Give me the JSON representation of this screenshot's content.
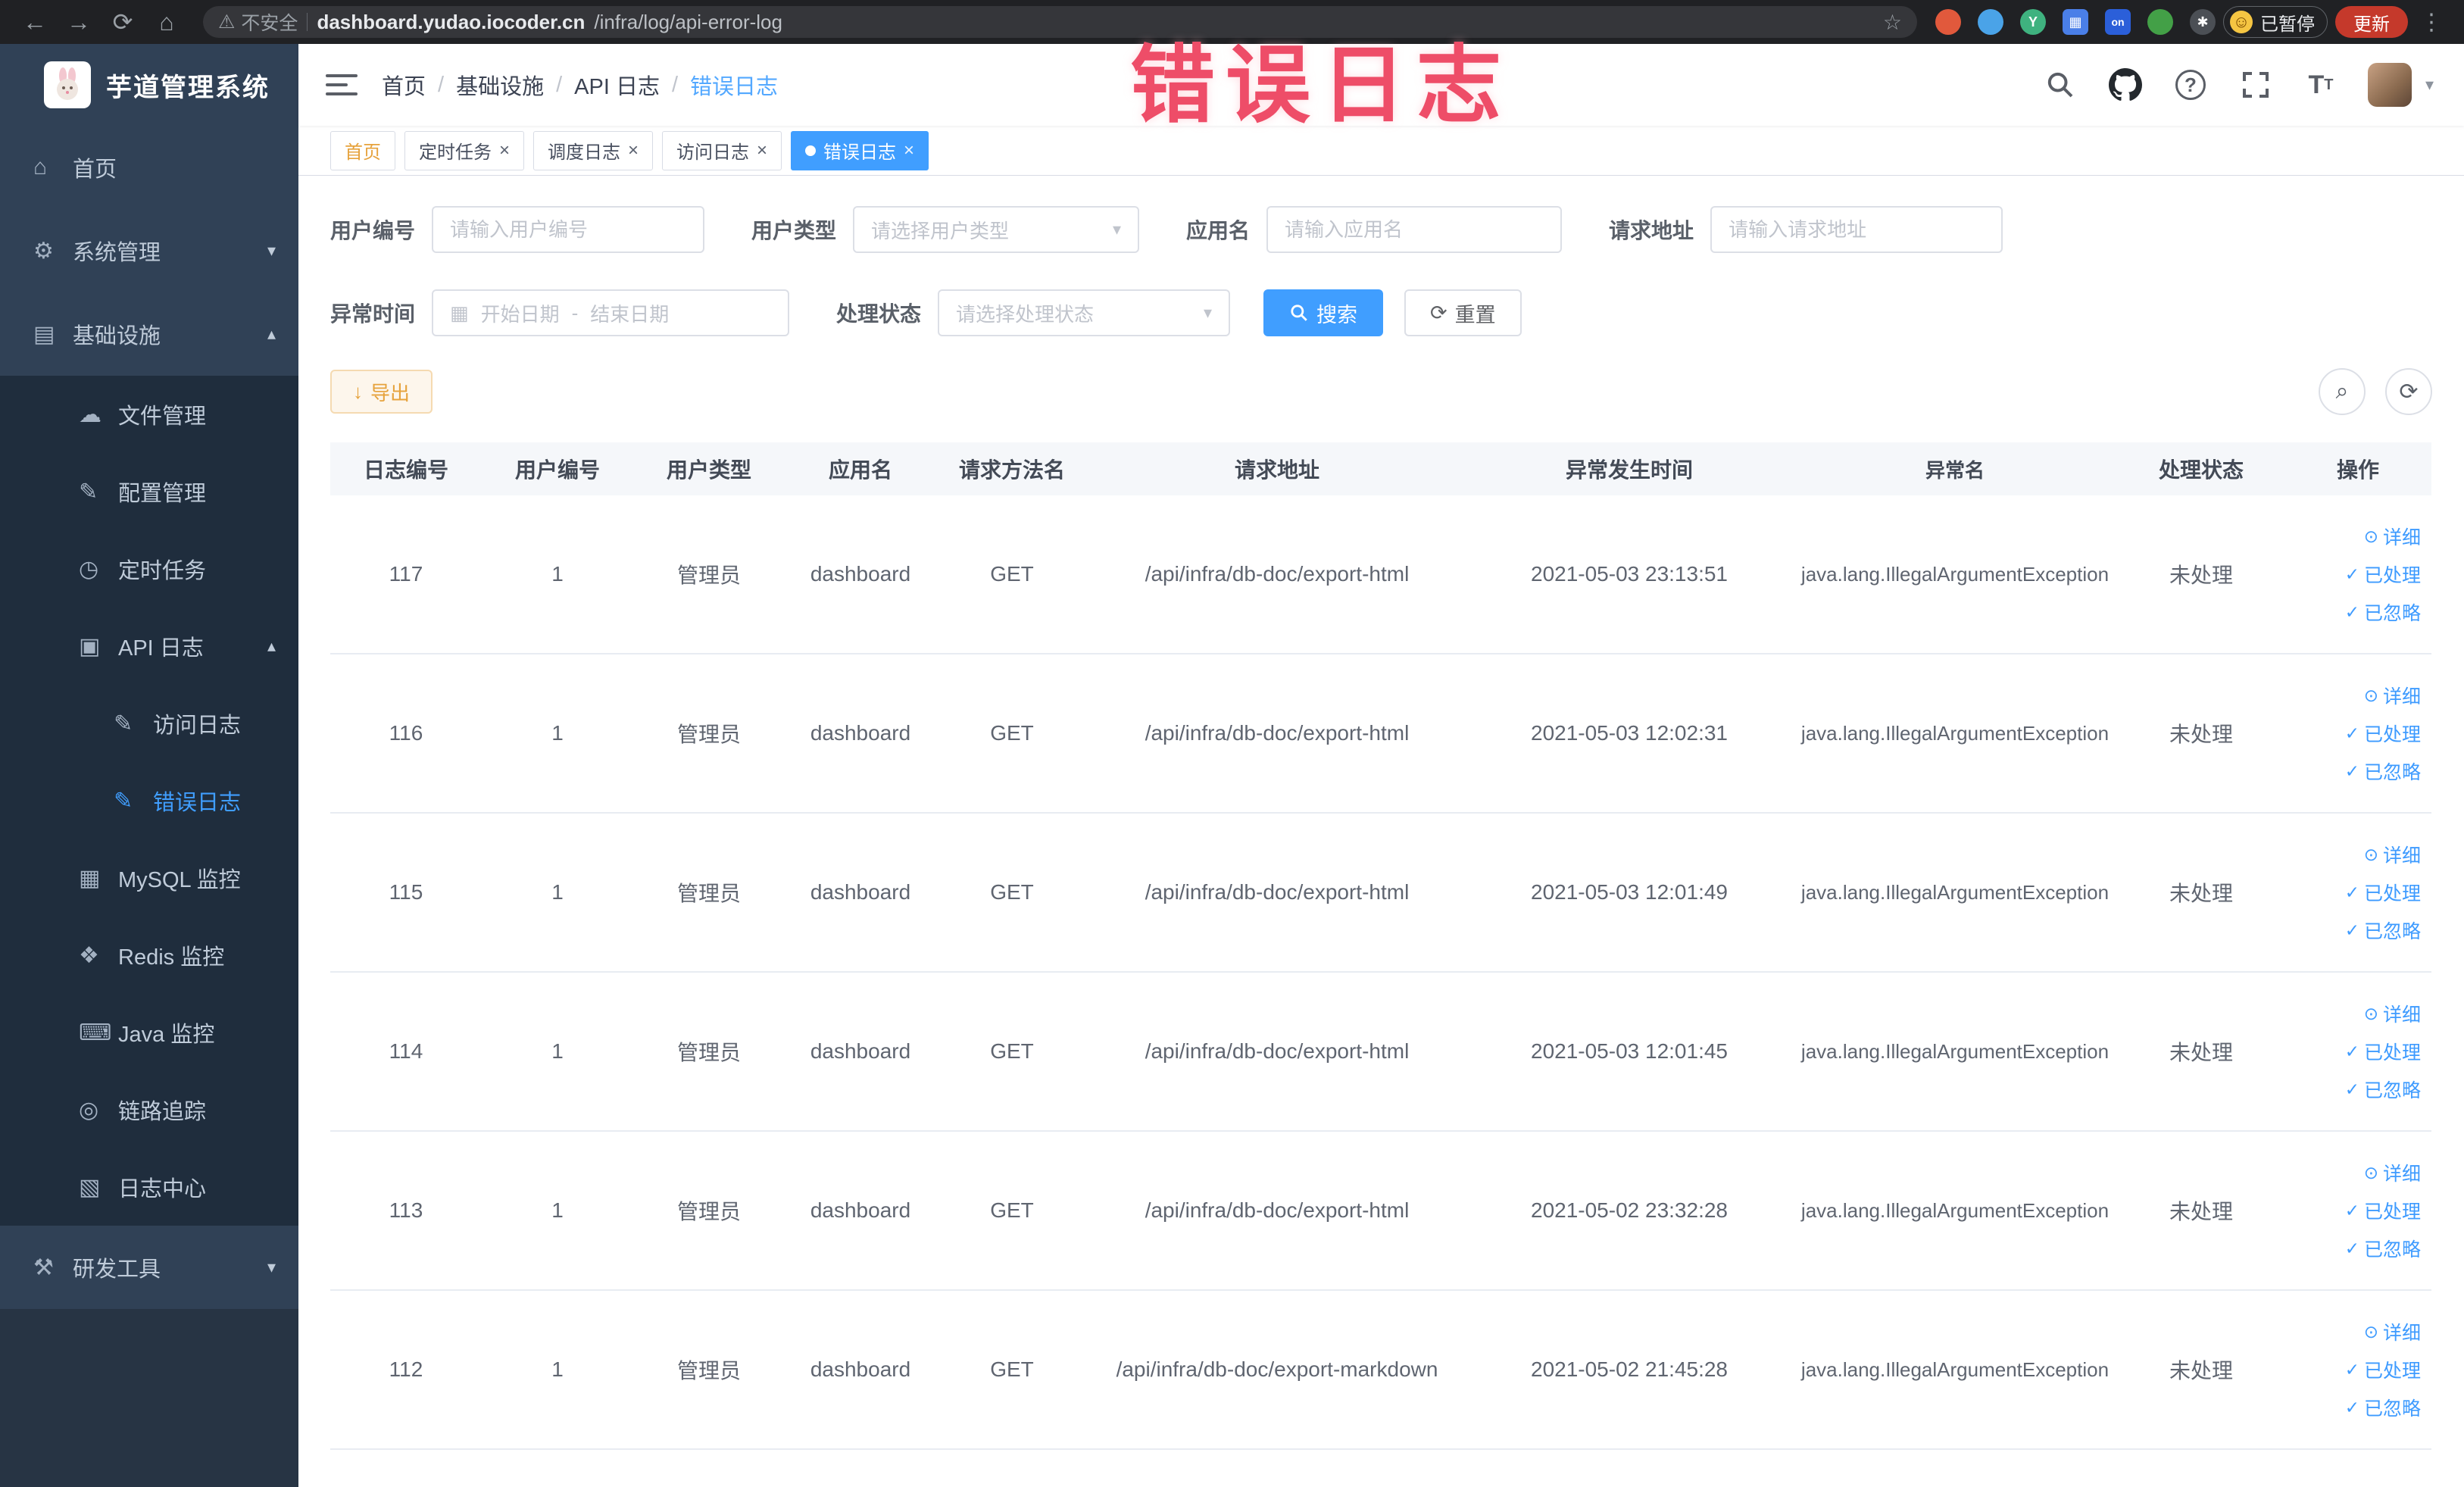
{
  "annotation": {
    "text": "错误日志"
  },
  "browser": {
    "security_label": "不安全",
    "url_host": "dashboard.yudao.iocoder.cn",
    "url_path": "/infra/log/api-error-log",
    "paused_badge": "已暂停",
    "update_button": "更新"
  },
  "sidebar": {
    "logo_title": "芋道管理系统",
    "items": [
      {
        "name": "home",
        "label": "首页",
        "level": 1,
        "icon": "home-icon"
      },
      {
        "name": "system",
        "label": "系统管理",
        "level": 1,
        "icon": "gear-icon",
        "arrow": "down"
      },
      {
        "name": "infra",
        "label": "基础设施",
        "level": 1,
        "icon": "infra-icon",
        "arrow": "up"
      },
      {
        "name": "file",
        "label": "文件管理",
        "level": 2,
        "icon": "cloud-icon"
      },
      {
        "name": "config",
        "label": "配置管理",
        "level": 2,
        "icon": "edit-icon"
      },
      {
        "name": "job",
        "label": "定时任务",
        "level": 2,
        "icon": "timer-icon"
      },
      {
        "name": "api-log",
        "label": "API 日志",
        "level": 2,
        "icon": "log-icon",
        "arrow": "up"
      },
      {
        "name": "access-log",
        "label": "访问日志",
        "level": 3,
        "icon": "doc-icon"
      },
      {
        "name": "error-log",
        "label": "错误日志",
        "level": 3,
        "icon": "doc-icon",
        "active": true
      },
      {
        "name": "mysql",
        "label": "MySQL 监控",
        "level": 2,
        "icon": "mysql-icon"
      },
      {
        "name": "redis",
        "label": "Redis 监控",
        "level": 2,
        "icon": "redis-icon"
      },
      {
        "name": "java",
        "label": "Java 监控",
        "level": 2,
        "icon": "java-icon"
      },
      {
        "name": "trace",
        "label": "链路追踪",
        "level": 2,
        "icon": "trace-icon"
      },
      {
        "name": "logcenter",
        "label": "日志中心",
        "level": 2,
        "icon": "logcenter-icon"
      },
      {
        "name": "devtools",
        "label": "研发工具",
        "level": 1,
        "icon": "tools-icon",
        "arrow": "down"
      }
    ]
  },
  "header": {
    "breadcrumb": [
      "首页",
      "基础设施",
      "API 日志",
      "错误日志"
    ]
  },
  "tabs": [
    {
      "name": "home",
      "label": "首页",
      "affix": true
    },
    {
      "name": "job",
      "label": "定时任务",
      "closable": true
    },
    {
      "name": "job-log",
      "label": "调度日志",
      "closable": true
    },
    {
      "name": "access-log",
      "label": "访问日志",
      "closable": true
    },
    {
      "name": "error-log",
      "label": "错误日志",
      "closable": true,
      "active": true
    }
  ],
  "filters": {
    "user_id": {
      "label": "用户编号",
      "placeholder": "请输入用户编号"
    },
    "user_type": {
      "label": "用户类型",
      "placeholder": "请选择用户类型"
    },
    "app_name": {
      "label": "应用名",
      "placeholder": "请输入应用名"
    },
    "request_url": {
      "label": "请求地址",
      "placeholder": "请输入请求地址"
    },
    "exception_time": {
      "label": "异常时间",
      "start_placeholder": "开始日期",
      "separator": "-",
      "end_placeholder": "结束日期"
    },
    "process_status": {
      "label": "处理状态",
      "placeholder": "请选择处理状态"
    },
    "search_button": "搜索",
    "reset_button": "重置"
  },
  "toolbar": {
    "export_button": "导出"
  },
  "table": {
    "columns": [
      "日志编号",
      "用户编号",
      "用户类型",
      "应用名",
      "请求方法名",
      "请求地址",
      "异常发生时间",
      "异常名",
      "处理状态",
      "操作"
    ],
    "actions": [
      "详细",
      "已处理",
      "已忽略"
    ],
    "rows": [
      {
        "id": "117",
        "user_id": "1",
        "user_type": "管理员",
        "app": "dashboard",
        "method": "GET",
        "url": "/api/infra/db-doc/export-html",
        "time": "2021-05-03 23:13:51",
        "exception": "java.lang.IllegalArgumentException",
        "status": "未处理"
      },
      {
        "id": "116",
        "user_id": "1",
        "user_type": "管理员",
        "app": "dashboard",
        "method": "GET",
        "url": "/api/infra/db-doc/export-html",
        "time": "2021-05-03 12:02:31",
        "exception": "java.lang.IllegalArgumentException",
        "status": "未处理"
      },
      {
        "id": "115",
        "user_id": "1",
        "user_type": "管理员",
        "app": "dashboard",
        "method": "GET",
        "url": "/api/infra/db-doc/export-html",
        "time": "2021-05-03 12:01:49",
        "exception": "java.lang.IllegalArgumentException",
        "status": "未处理"
      },
      {
        "id": "114",
        "user_id": "1",
        "user_type": "管理员",
        "app": "dashboard",
        "method": "GET",
        "url": "/api/infra/db-doc/export-html",
        "time": "2021-05-03 12:01:45",
        "exception": "java.lang.IllegalArgumentException",
        "status": "未处理"
      },
      {
        "id": "113",
        "user_id": "1",
        "user_type": "管理员",
        "app": "dashboard",
        "method": "GET",
        "url": "/api/infra/db-doc/export-html",
        "time": "2021-05-02 23:32:28",
        "exception": "java.lang.IllegalArgumentException",
        "status": "未处理"
      },
      {
        "id": "112",
        "user_id": "1",
        "user_type": "管理员",
        "app": "dashboard",
        "method": "GET",
        "url": "/api/infra/db-doc/export-markdown",
        "time": "2021-05-02 21:45:28",
        "exception": "java.lang.IllegalArgumentException",
        "status": "未处理"
      }
    ]
  }
}
